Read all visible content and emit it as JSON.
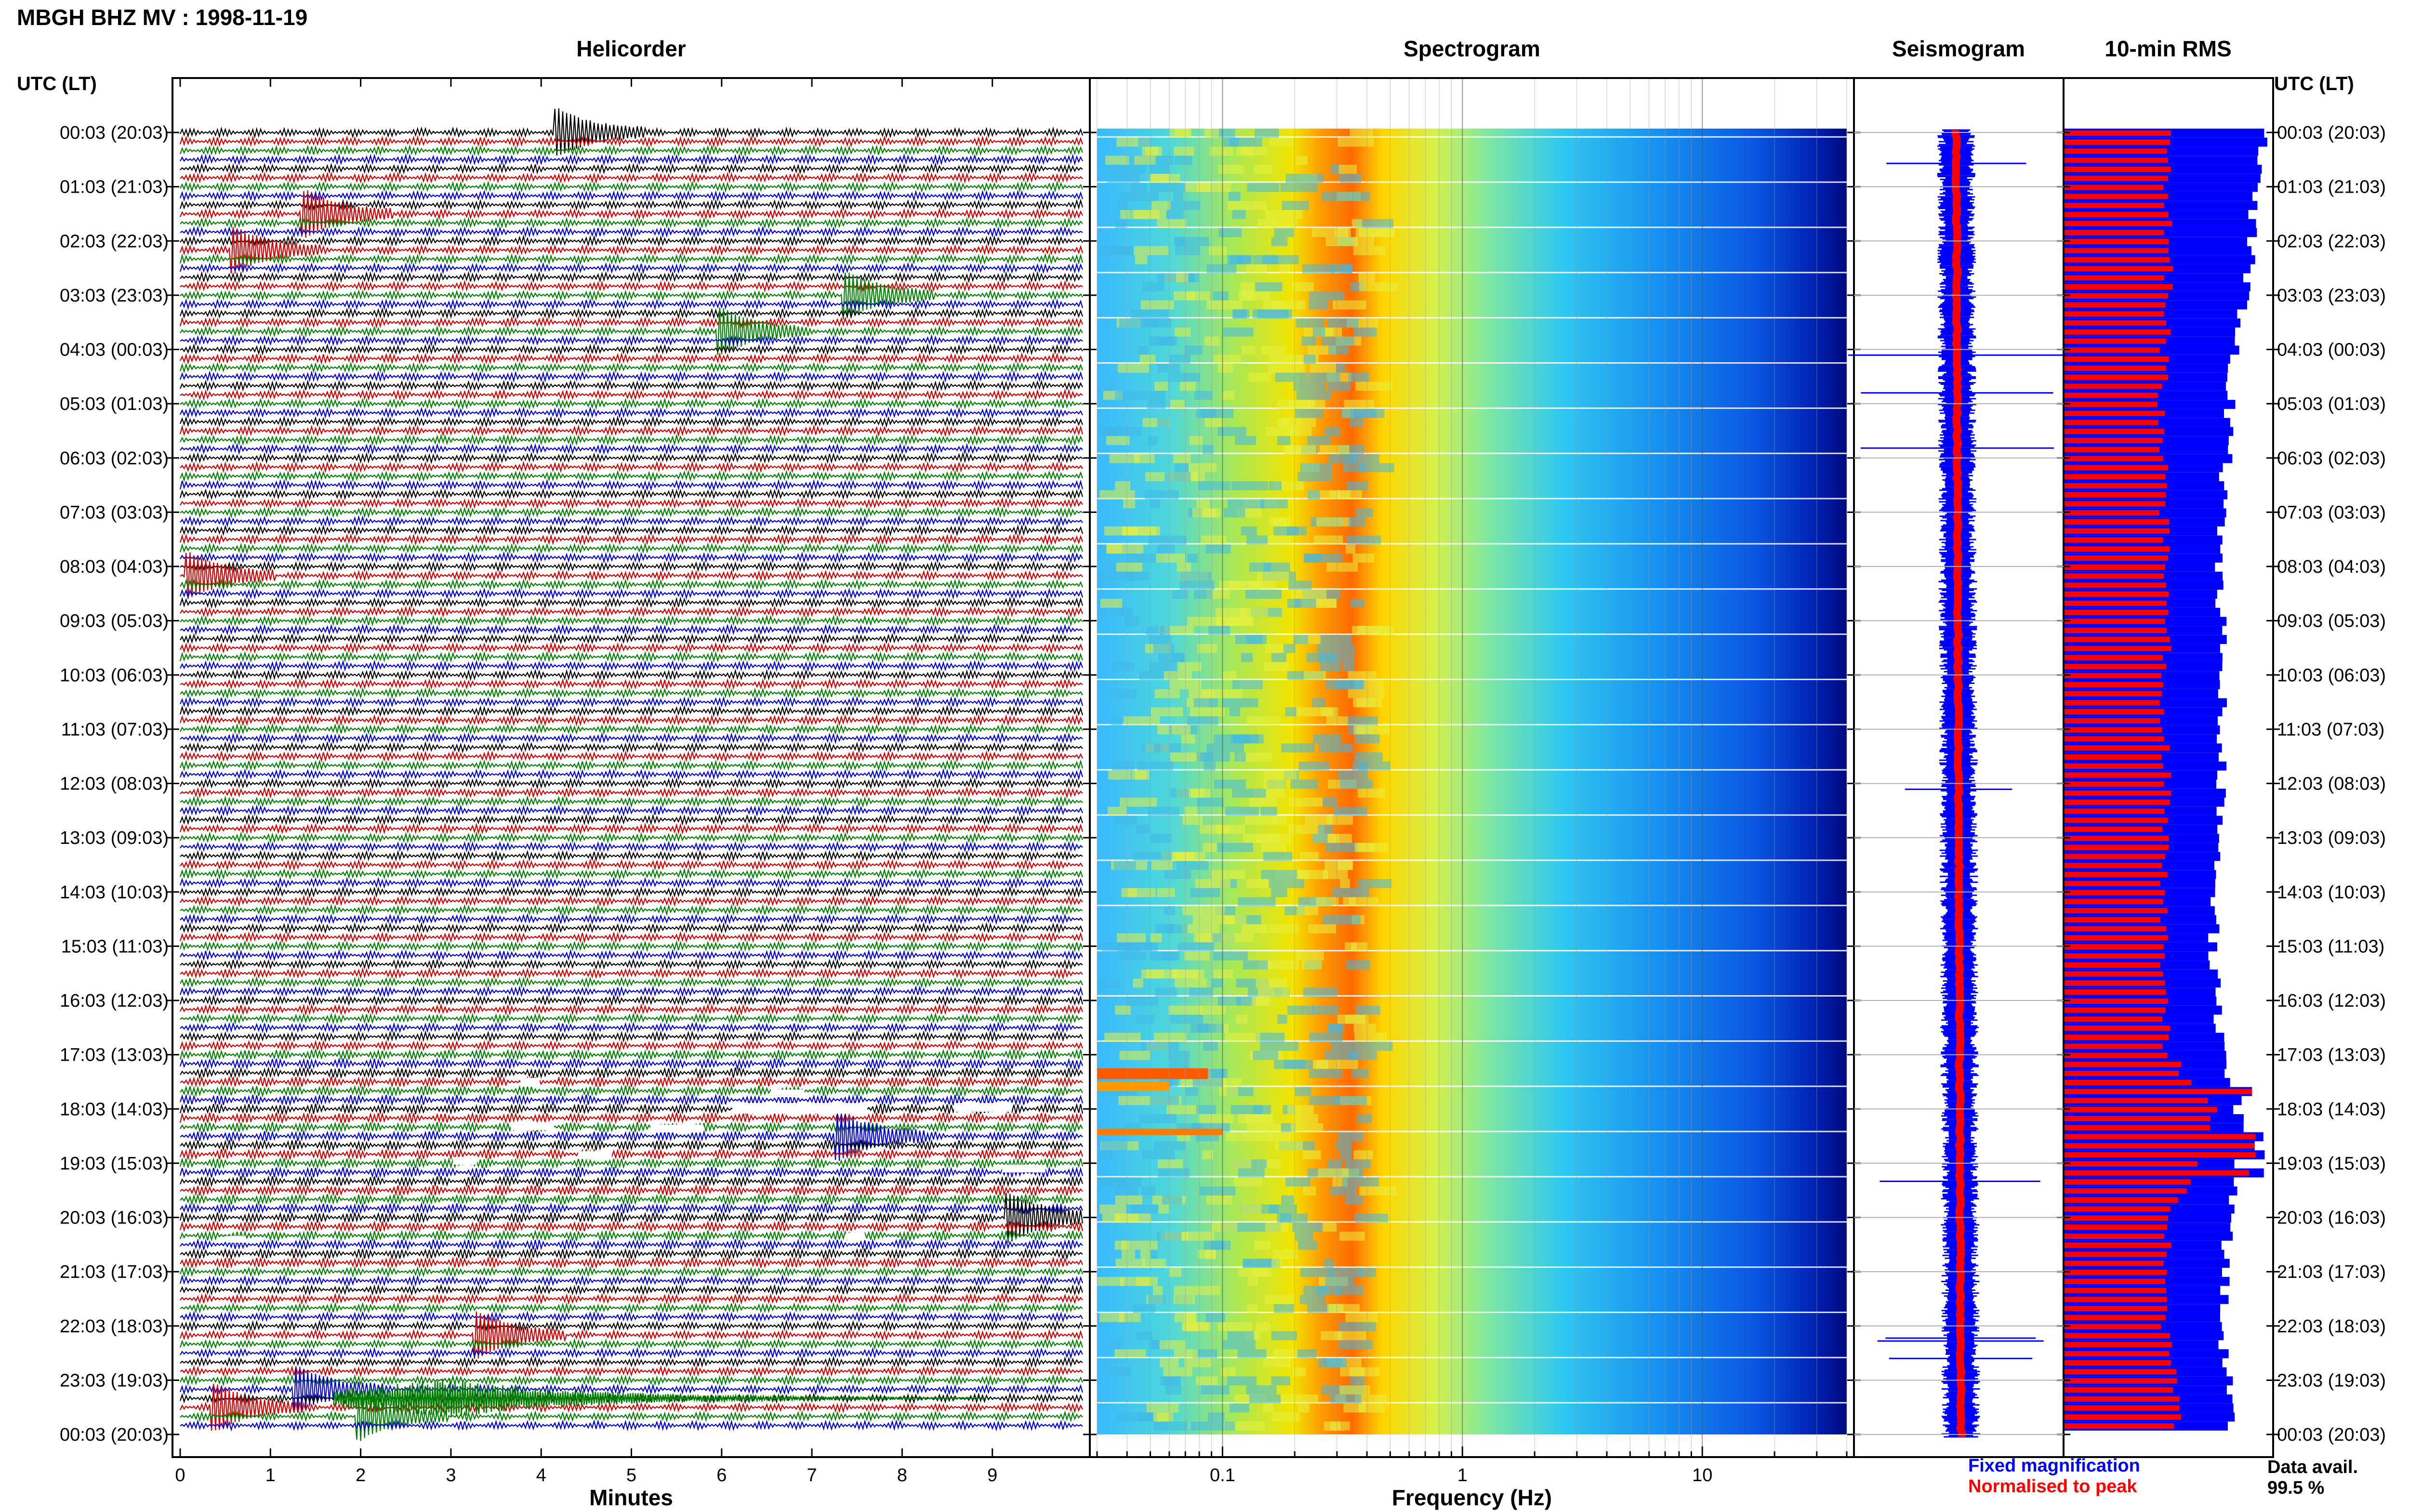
{
  "header": {
    "title": "MBGH BHZ MV : 1998-11-19",
    "time_axis_label": "UTC (LT)"
  },
  "panels": {
    "helicorder": "Helicorder",
    "spectrogram": "Spectrogram",
    "seismogram": "Seismogram",
    "rms": "10-min RMS"
  },
  "legend": {
    "fixed": "Fixed magnification",
    "normalised": "Normalised to peak",
    "fixed_color": "#0000ff",
    "normalised_color": "#ff0000"
  },
  "data_availability": {
    "label": "Data avail.",
    "value": "99.5 %"
  },
  "chart_data": [
    {
      "type": "line",
      "panel": "helicorder",
      "xlabel": "Minutes",
      "x_ticks": [
        "0",
        "1",
        "2",
        "3",
        "4",
        "5",
        "6",
        "7",
        "8",
        "9"
      ],
      "xlim": [
        0,
        10
      ],
      "y_ticks": [
        "00:03 (20:03)",
        "01:03 (21:03)",
        "02:03 (22:03)",
        "03:03 (23:03)",
        "04:03 (00:03)",
        "05:03 (01:03)",
        "06:03 (02:03)",
        "07:03 (03:03)",
        "08:03 (04:03)",
        "09:03 (05:03)",
        "10:03 (06:03)",
        "11:03 (07:03)",
        "12:03 (08:03)",
        "13:03 (09:03)",
        "14:03 (10:03)",
        "15:03 (11:03)",
        "16:03 (12:03)",
        "17:03 (13:03)",
        "18:03 (14:03)",
        "19:03 (15:03)",
        "20:03 (16:03)",
        "21:03 (17:03)",
        "22:03 (18:03)",
        "23:03 (19:03)",
        "00:03 (20:03)"
      ],
      "trace_colors": [
        "#000000",
        "#cc0000",
        "#008000",
        "#0000cc"
      ],
      "traces_per_hour": 6,
      "events": [
        {
          "time": "00:10",
          "minute": 4.2,
          "color": "#0000cc"
        },
        {
          "time": "01:33",
          "minute": 1.4,
          "color": "#008000"
        },
        {
          "time": "02:13",
          "minute": 0.6,
          "color": "#008000"
        },
        {
          "time": "03:43",
          "minute": 6.0,
          "color": "#000000"
        },
        {
          "time": "03:03",
          "minute": 7.4,
          "color": "#0000cc"
        },
        {
          "time": "08:13",
          "minute": 0.1,
          "color": "#008000"
        },
        {
          "time": "18:33",
          "minute": 7.3,
          "color": "#000000"
        },
        {
          "time": "20:03",
          "minute": 9.2,
          "color": "#008000"
        },
        {
          "time": "22:13",
          "minute": 3.3,
          "color": "#0000cc"
        },
        {
          "time": "23:13",
          "minute": 1.3,
          "color": "#008000"
        },
        {
          "time": "23:33",
          "minute": 0.4,
          "color": "#cc0000"
        },
        {
          "time": "23:43",
          "minute": 2.0,
          "color": "#008000"
        }
      ]
    },
    {
      "type": "heatmap",
      "panel": "spectrogram",
      "xlabel": "Frequency (Hz)",
      "x_scale": "log",
      "x_ticks": [
        "0.1",
        "1",
        "10"
      ],
      "xlim": [
        0.03,
        40
      ],
      "colormap": "jet",
      "peak_band_hz": [
        0.2,
        0.6
      ],
      "rows": 144
    },
    {
      "type": "line",
      "panel": "seismogram",
      "series": [
        {
          "name": "Fixed magnification",
          "color": "#0000ff"
        },
        {
          "name": "Normalised to peak",
          "color": "#ff0000"
        }
      ]
    },
    {
      "type": "bar",
      "panel": "rms",
      "orientation": "horizontal",
      "series": [
        {
          "name": "Fixed magnification",
          "color": "#0000ff"
        },
        {
          "name": "Normalised to peak",
          "color": "#ff0000"
        }
      ],
      "rows": 144,
      "fixed_profile": [
        [
          "00:03",
          0.98
        ],
        [
          "01:03",
          0.92
        ],
        [
          "02:03",
          0.9
        ],
        [
          "03:03",
          0.88
        ],
        [
          "04:03",
          0.82
        ],
        [
          "05:03",
          0.8
        ],
        [
          "06:03",
          0.78
        ],
        [
          "07:03",
          0.76
        ],
        [
          "08:03",
          0.74
        ],
        [
          "09:03",
          0.76
        ],
        [
          "10:03",
          0.77
        ],
        [
          "11:03",
          0.76
        ],
        [
          "12:03",
          0.76
        ],
        [
          "13:03",
          0.74
        ],
        [
          "14:03",
          0.73
        ],
        [
          "15:03",
          0.72
        ],
        [
          "16:03",
          0.73
        ],
        [
          "17:03",
          0.78
        ],
        [
          "18:03",
          0.84
        ],
        [
          "19:03",
          0.84
        ],
        [
          "20:03",
          0.79
        ],
        [
          "21:03",
          0.78
        ],
        [
          "22:03",
          0.75
        ],
        [
          "23:03",
          0.8
        ]
      ],
      "normalised_profile": [
        [
          "00:03",
          0.52
        ],
        [
          "01:03",
          0.5
        ],
        [
          "02:03",
          0.5
        ],
        [
          "03:03",
          0.5
        ],
        [
          "04:03",
          0.48
        ],
        [
          "05:03",
          0.47
        ],
        [
          "06:03",
          0.48
        ],
        [
          "07:03",
          0.48
        ],
        [
          "08:03",
          0.5
        ],
        [
          "09:03",
          0.5
        ],
        [
          "10:03",
          0.48
        ],
        [
          "11:03",
          0.48
        ],
        [
          "12:03",
          0.5
        ],
        [
          "13:03",
          0.48
        ],
        [
          "14:03",
          0.48
        ],
        [
          "15:03",
          0.48
        ],
        [
          "16:03",
          0.48
        ],
        [
          "17:03",
          0.5
        ],
        [
          "18:03",
          0.72
        ],
        [
          "19:03",
          0.66
        ],
        [
          "20:03",
          0.5
        ],
        [
          "21:03",
          0.5
        ],
        [
          "22:03",
          0.48
        ],
        [
          "23:03",
          0.54
        ]
      ]
    }
  ]
}
